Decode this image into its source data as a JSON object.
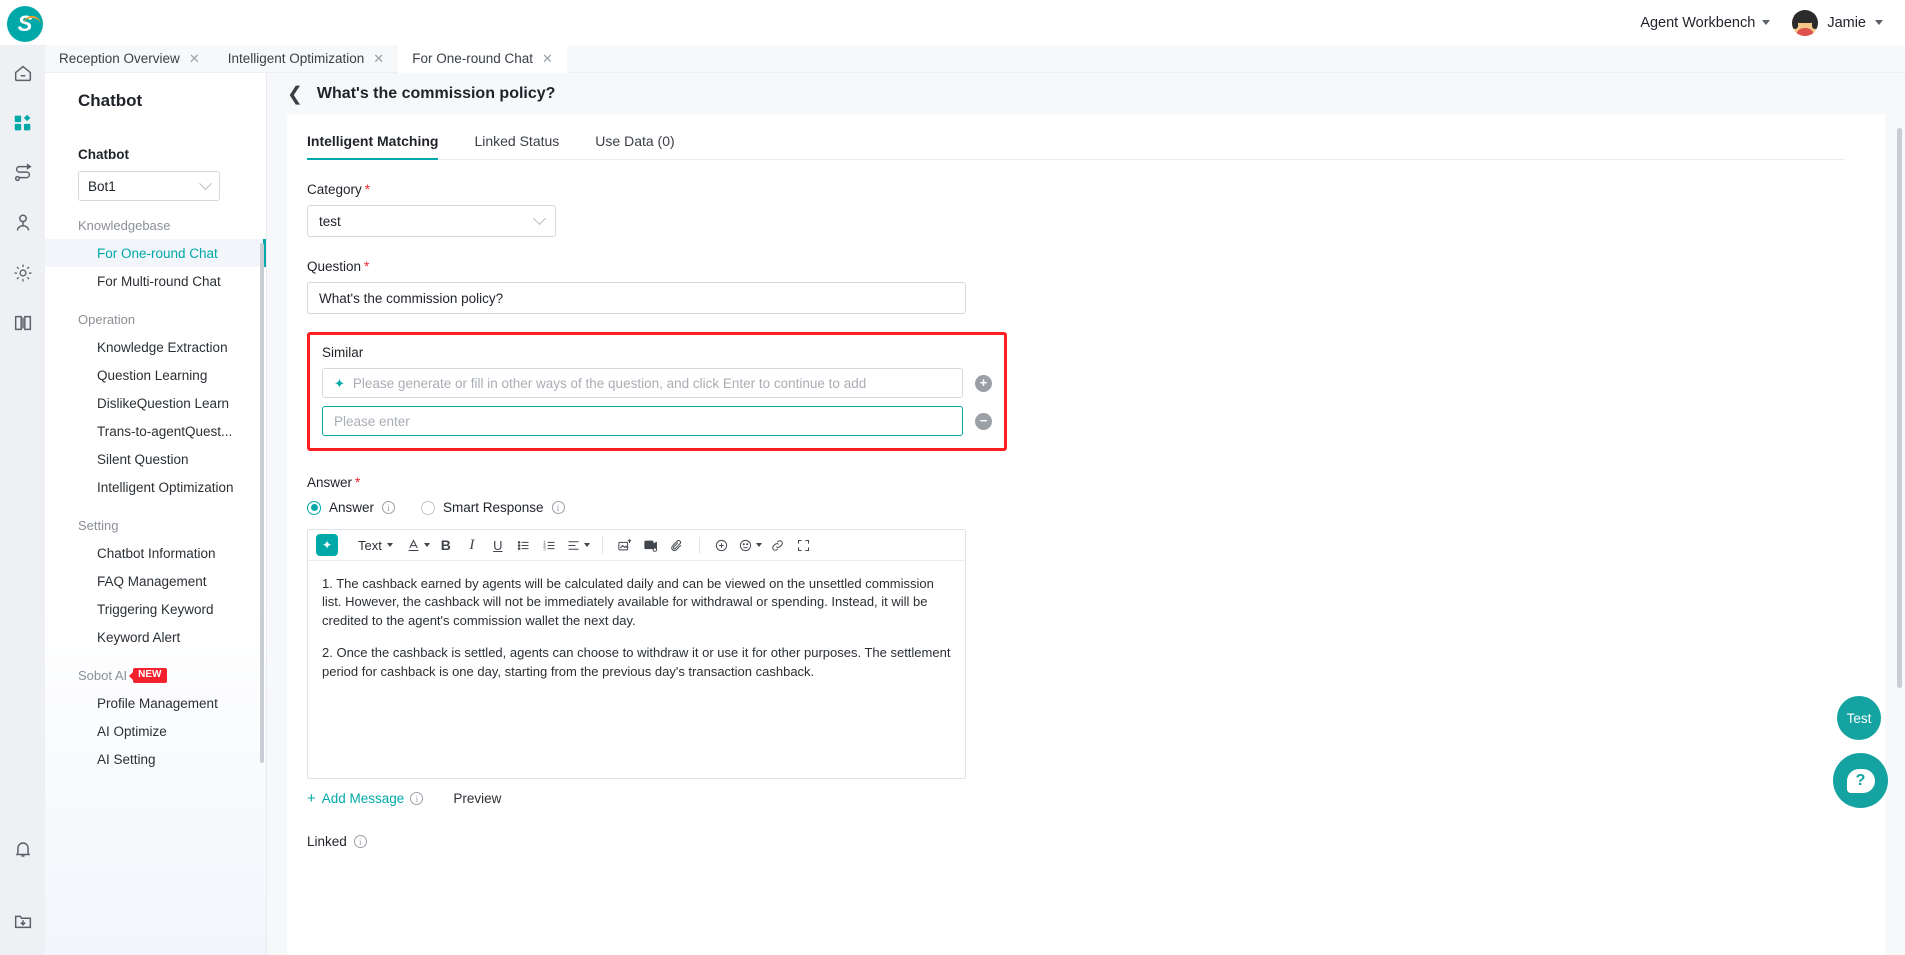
{
  "topbar": {
    "workbench_label": "Agent Workbench",
    "user_name": "Jamie"
  },
  "browser_tabs": [
    {
      "label": "Reception Overview",
      "close": "✕"
    },
    {
      "label": "Intelligent Optimization",
      "close": "✕"
    },
    {
      "label": "For One-round Chat",
      "close": "✕"
    }
  ],
  "rail_icons": [
    "home-icon",
    "apps-icon",
    "workflow-icon",
    "person-icon",
    "gear-icon",
    "book-icon",
    "bell-icon",
    "download-folder-icon"
  ],
  "sidebar": {
    "title": "Chatbot",
    "select_label": "Chatbot",
    "select_value": "Bot1",
    "groups": [
      {
        "name": "Knowledgebase",
        "items": [
          {
            "label": "For One-round Chat",
            "active": true
          },
          {
            "label": "For Multi-round Chat",
            "active": false
          }
        ]
      },
      {
        "name": "Operation",
        "items": [
          {
            "label": "Knowledge Extraction",
            "active": false
          },
          {
            "label": "Question Learning",
            "active": false
          },
          {
            "label": "DislikeQuestion Learn",
            "active": false
          },
          {
            "label": "Trans-to-agentQuest...",
            "active": false
          },
          {
            "label": "Silent Question",
            "active": false
          },
          {
            "label": "Intelligent Optimization",
            "active": false
          }
        ]
      },
      {
        "name": "Setting",
        "items": [
          {
            "label": "Chatbot Information",
            "active": false
          },
          {
            "label": "FAQ Management",
            "active": false
          },
          {
            "label": "Triggering Keyword",
            "active": false
          },
          {
            "label": "Keyword Alert",
            "active": false
          }
        ]
      },
      {
        "name": "Sobot AI",
        "badge": "NEW",
        "items": [
          {
            "label": "Profile Management",
            "active": false
          },
          {
            "label": "AI Optimize",
            "active": false
          },
          {
            "label": "AI Setting",
            "active": false
          }
        ]
      }
    ]
  },
  "main": {
    "page_title": "What's the commission policy?",
    "tabs": [
      {
        "label": "Intelligent Matching",
        "active": true
      },
      {
        "label": "Linked Status",
        "active": false
      },
      {
        "label": "Use Data (0)",
        "active": false
      }
    ],
    "category": {
      "label": "Category",
      "value": "test"
    },
    "question": {
      "label": "Question",
      "value": "What's the commission policy?"
    },
    "similar": {
      "label": "Similar",
      "row1_placeholder": "Please generate or fill in other ways of the question, and click Enter to continue to add",
      "row1_value": "",
      "row2_placeholder": "Please enter",
      "row2_value": "",
      "add_button": "+",
      "remove_button": "−",
      "highlight_color": "#ff1f1f"
    },
    "answer": {
      "label": "Answer",
      "option_answer": "Answer",
      "option_smart": "Smart Response",
      "selected": "Answer",
      "toolbar": {
        "ai_label": "ai-sparkle",
        "text_label": "Text",
        "items": [
          "font-color-icon",
          "bold-icon",
          "italic-icon",
          "underline-icon",
          "bullet-list-icon",
          "numbered-list-icon",
          "align-icon",
          "image-upload-icon",
          "video-icon",
          "attachment-icon",
          "insert-icon",
          "emoji-icon",
          "link-icon",
          "fullscreen-icon"
        ]
      },
      "body_paragraphs": [
        "1. The cashback earned by agents will be calculated daily and can be viewed on the unsettled commission list. However, the cashback will not be immediately available for withdrawal or spending. Instead, it will be credited to the agent's commission wallet the next day.",
        "2. Once the cashback is settled, agents can choose to withdraw it or use it for other purposes. The settlement period for cashback is one day, starting from the previous day's transaction cashback."
      ]
    },
    "add_message": "Add Message",
    "preview": "Preview",
    "linked": "Linked"
  },
  "floating": {
    "test_label": "Test",
    "help_label": "?"
  },
  "colors": {
    "accent": "#00a9a7",
    "danger": "#f5222d",
    "highlight": "#ff1f1f"
  }
}
